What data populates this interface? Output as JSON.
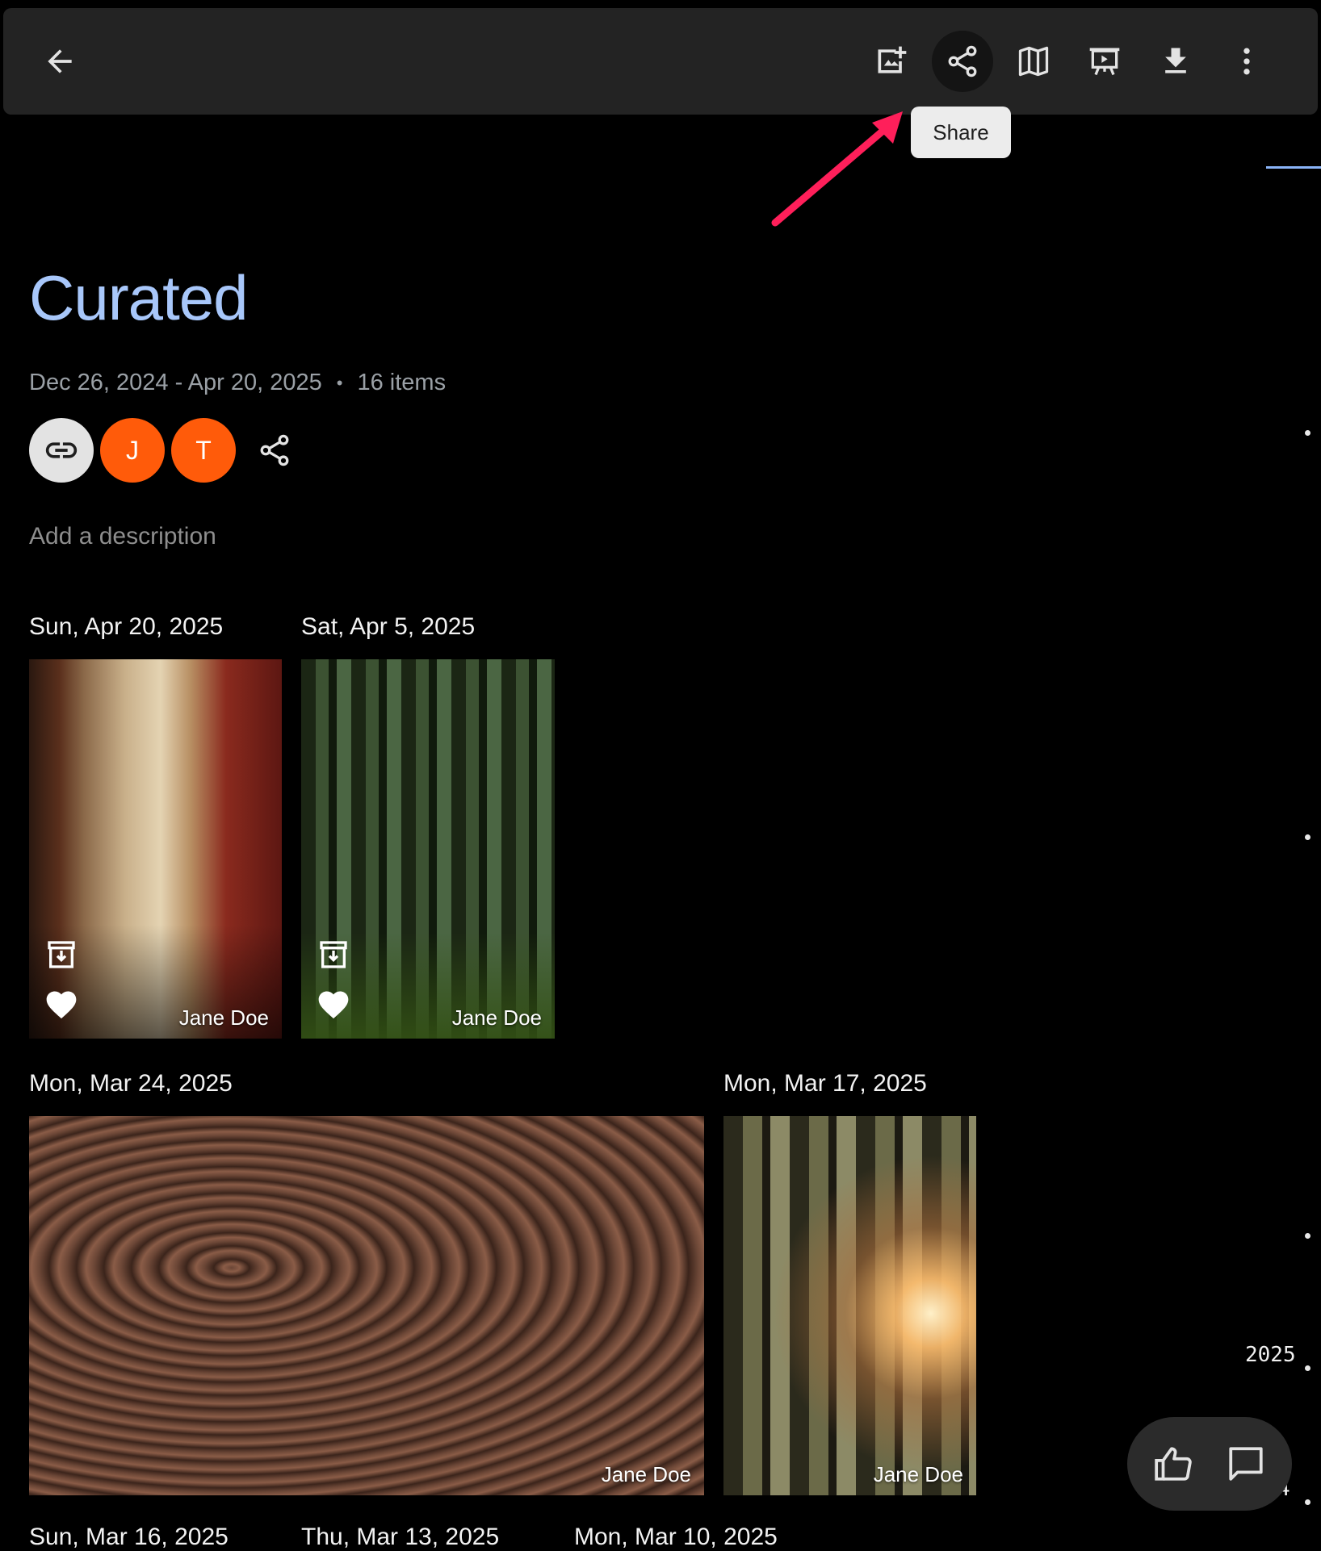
{
  "toolbar": {
    "back_icon": "arrow-left-icon",
    "actions": [
      {
        "icon": "add-photo-icon",
        "label": "Add photos"
      },
      {
        "icon": "share-icon",
        "label": "Share"
      },
      {
        "icon": "map-icon",
        "label": "Map"
      },
      {
        "icon": "slideshow-icon",
        "label": "Slideshow"
      },
      {
        "icon": "download-icon",
        "label": "Download"
      },
      {
        "icon": "more-vert-icon",
        "label": "More options"
      }
    ],
    "tooltip": "Share"
  },
  "album": {
    "title": "Curated",
    "date_range": "Dec 26, 2024 - Apr 20, 2025",
    "separator": "•",
    "item_count": "16 items",
    "description_placeholder": "Add a description",
    "members": [
      {
        "initial": "J",
        "color": "#ff5b0a"
      },
      {
        "initial": "T",
        "color": "#ff5b0a"
      }
    ]
  },
  "groups": [
    {
      "date": "Sun, Apr 20, 2025",
      "photos": [
        {
          "owner": "Jane Doe",
          "archived": true,
          "favorite": true
        }
      ]
    },
    {
      "date": "Sat, Apr 5, 2025",
      "photos": [
        {
          "owner": "Jane Doe",
          "archived": true,
          "favorite": true
        }
      ]
    },
    {
      "date": "Mon, Mar 24, 2025",
      "photos": [
        {
          "owner": "Jane Doe"
        }
      ]
    },
    {
      "date": "Mon, Mar 17, 2025",
      "photos": [
        {
          "owner": "Jane Doe"
        }
      ]
    },
    {
      "date": "Sun, Mar 16, 2025"
    },
    {
      "date": "Thu, Mar 13, 2025"
    },
    {
      "date": "Mon, Mar 10, 2025"
    }
  ],
  "scrubber": {
    "year": "2025",
    "partial_label": "4"
  },
  "fab": {
    "like_icon": "thumb-up-icon",
    "comment_icon": "comment-icon"
  },
  "colors": {
    "accent": "#a8c7fa",
    "avatar": "#ff5b0a",
    "annotation_arrow": "#ff1f5a",
    "toolbar_bg": "#232323"
  }
}
